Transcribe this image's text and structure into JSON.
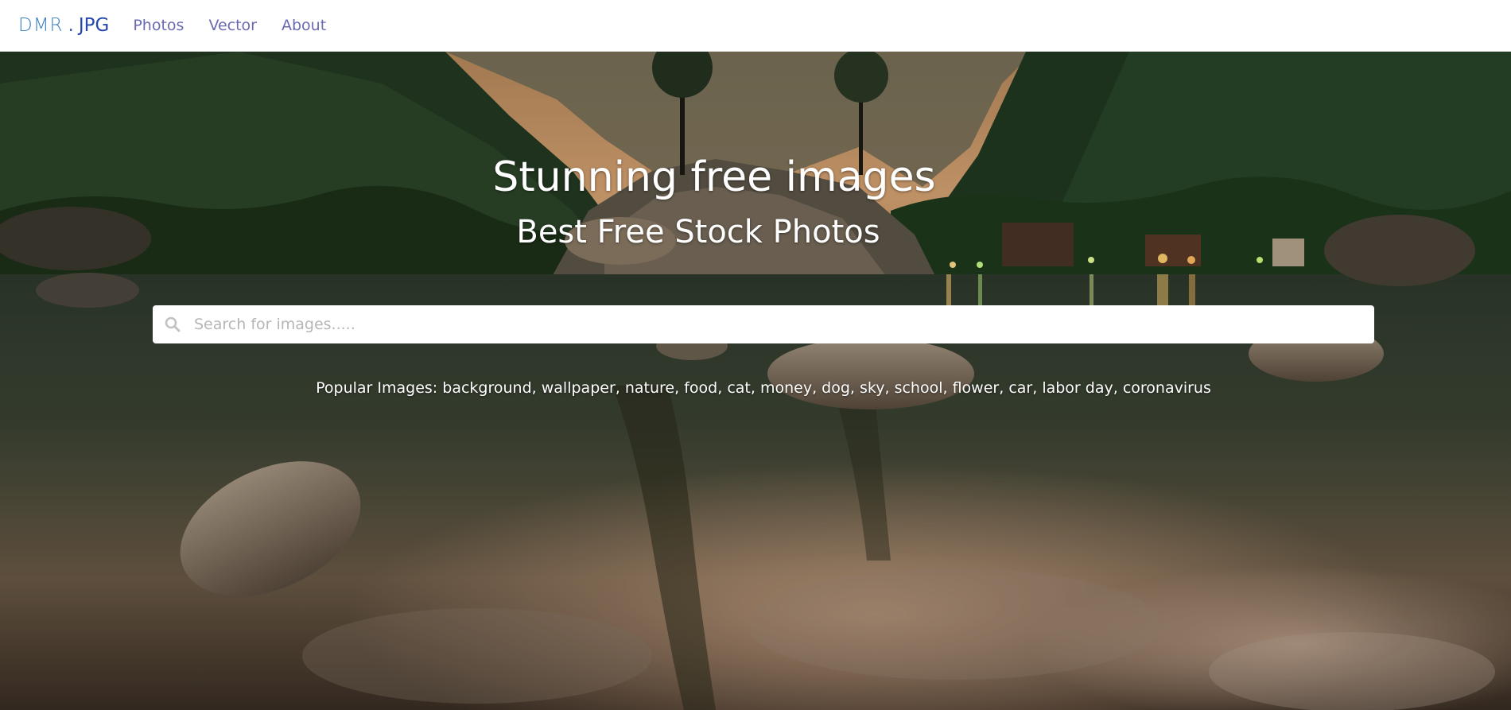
{
  "nav": {
    "logo_part1": "DMR",
    "logo_dot": ".",
    "logo_part2": "JPG",
    "links": [
      "Photos",
      "Vector",
      "About"
    ]
  },
  "hero": {
    "title": "Stunning free images",
    "subtitle": "Best Free Stock Photos",
    "search_placeholder": "Search for images.....",
    "popular_label": "Popular Images:",
    "popular_tags": [
      "background",
      "wallpaper",
      "nature",
      "food",
      "cat",
      "money",
      "dog",
      "sky",
      "school",
      "flower",
      "car",
      "labor day",
      "coronavirus"
    ]
  },
  "colors": {
    "logo_dmr": "#3b7fc4",
    "logo_jpg": "#2646b0",
    "nav_link": "#6a6ab0"
  },
  "icons": {
    "search": "search-icon"
  }
}
